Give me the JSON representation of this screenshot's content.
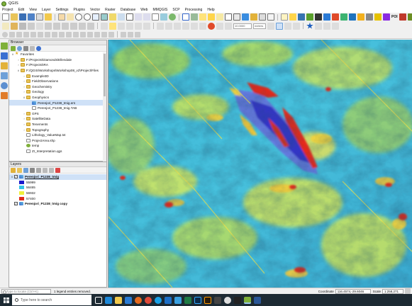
{
  "window": {
    "title": "QGIS"
  },
  "menu": [
    "Project",
    "Edit",
    "View",
    "Layer",
    "Settings",
    "Plugins",
    "Vector",
    "Raster",
    "Database",
    "Web",
    "MMQGIS",
    "SCP",
    "Processing",
    "Help"
  ],
  "toolbars": {
    "poi_label": "POI",
    "scale_value": "10.0000",
    "unit_value": "meters"
  },
  "browser": {
    "title": "Browser",
    "items": [
      {
        "label": "Favorites",
        "level": 0,
        "arrow": "v",
        "icon": "star"
      },
      {
        "label": "F:/Projects\\Diamonds\\Ellendale",
        "level": 1,
        "arrow": ">",
        "icon": "folder"
      },
      {
        "label": "F:/Projects\\IRA",
        "level": 1,
        "arrow": ">",
        "icon": "folder"
      },
      {
        "label": "F:/QGIS\\Workshops\\Workshop08_v2\\Project\\Files",
        "level": 1,
        "arrow": "v",
        "icon": "folder"
      },
      {
        "label": "Example3D",
        "level": 2,
        "arrow": ">",
        "icon": "folder"
      },
      {
        "label": "FieldObservations",
        "level": 2,
        "arrow": ">",
        "icon": "folder"
      },
      {
        "label": "Geochemistry",
        "level": 2,
        "arrow": ">",
        "icon": "folder"
      },
      {
        "label": "Geology",
        "level": 2,
        "arrow": ">",
        "icon": "folder"
      },
      {
        "label": "Geophysics",
        "level": 2,
        "arrow": "v",
        "icon": "folder"
      },
      {
        "label": "Perenjori_P1238_tmig.ers",
        "level": 3,
        "arrow": "",
        "icon": "raster",
        "selected": true
      },
      {
        "label": "Perenjori_P1238_tmig.TAB",
        "level": 3,
        "arrow": "",
        "icon": "file"
      },
      {
        "label": "GPS",
        "level": 2,
        "arrow": ">",
        "icon": "folder"
      },
      {
        "label": "SatelliteData",
        "level": 2,
        "arrow": ">",
        "icon": "folder"
      },
      {
        "label": "Tenements",
        "level": 2,
        "arrow": ">",
        "icon": "folder"
      },
      {
        "label": "Topography",
        "level": 2,
        "arrow": ">",
        "icon": "folder"
      },
      {
        "label": "Lithology_ValueMap.txt",
        "level": 2,
        "arrow": "",
        "icon": "file"
      },
      {
        "label": "ProjectArea.shp",
        "level": 2,
        "arrow": "",
        "icon": "file"
      },
      {
        "label": "temp",
        "level": 2,
        "arrow": "",
        "icon": "shp"
      },
      {
        "label": "ZI_Interpretation.qgs",
        "level": 2,
        "arrow": "",
        "icon": "file"
      }
    ]
  },
  "layers": {
    "title": "Layers",
    "items": [
      {
        "name": "Perenjori_P1238_tmig",
        "checked": true,
        "selected": true,
        "legend": [
          {
            "value": "55999",
            "color": "#1a1acc"
          },
          {
            "value": "56465",
            "color": "#33c3e6"
          },
          {
            "value": "56932",
            "color": "#f0f03a"
          },
          {
            "value": "57400",
            "color": "#e02a1a"
          }
        ]
      },
      {
        "name": "Perenjori_P1238_tmig copy",
        "checked": true,
        "selected": false,
        "legend": []
      }
    ]
  },
  "statusbar": {
    "locator_placeholder": "Type to locate (Ctrl+K)",
    "message": "1 legend entries removed.",
    "coordinate_label": "Coordinate",
    "coordinate_value": "116.4574,-29.6046",
    "scale_label": "Scale",
    "scale_value": "1:258,271"
  },
  "taskbar": {
    "search_placeholder": "Type here to search"
  },
  "colors": {
    "legend_low": "#1a1acc",
    "legend_mid_low": "#33c3e6",
    "legend_mid_high": "#f0f03a",
    "legend_high": "#e02a1a"
  }
}
